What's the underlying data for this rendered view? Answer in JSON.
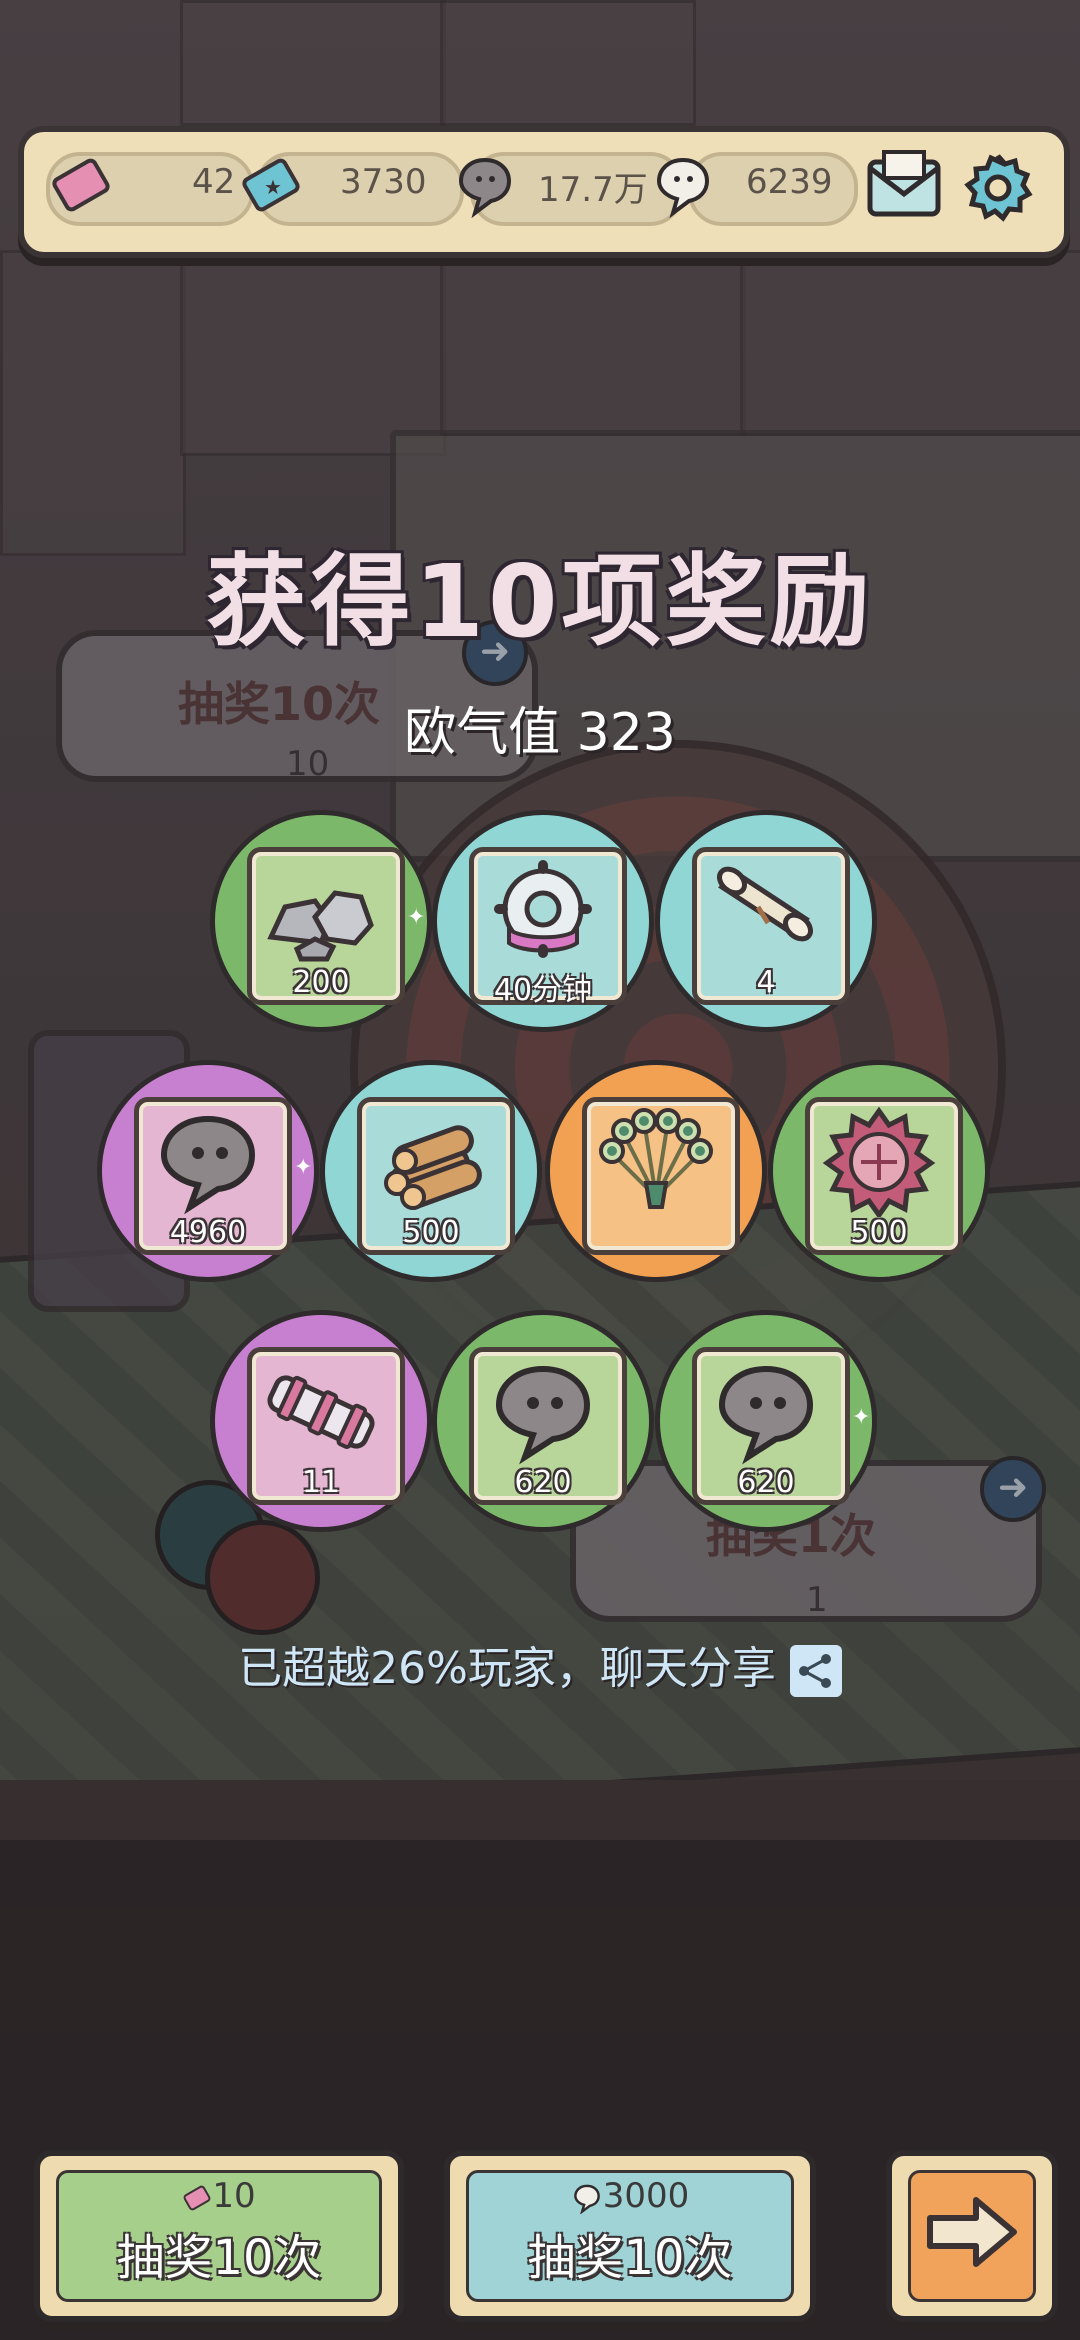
{
  "topbar": {
    "ticket_pink": {
      "icon": "pink-ticket-icon",
      "value": "42"
    },
    "ticket_blue": {
      "icon": "blue-ticket-icon",
      "value": "3730"
    },
    "dark_blob": {
      "icon": "dark-blob-icon",
      "value": "17.7万"
    },
    "white_blob": {
      "icon": "white-blob-icon",
      "value": "6239"
    },
    "mail": {
      "icon": "mail-icon"
    },
    "settings": {
      "icon": "gear-icon"
    }
  },
  "panel": {
    "title": "获得10项奖励",
    "luck_label": "欧气值 323",
    "share_text": "已超越26%玩家，聊天分享",
    "share_icon": "share-icon"
  },
  "background_text": {
    "draw10": "抽奖10次",
    "draw10_cost": "10",
    "draw1": "抽奖1次",
    "draw1_cost": "1"
  },
  "rewards": [
    {
      "name": "stones",
      "icon": "stone-pile-icon",
      "qty": "200",
      "rarity": "green",
      "sparkle": true
    },
    {
      "name": "gear-time",
      "icon": "gear-clock-icon",
      "qty": "40分钟",
      "rarity": "teal",
      "sparkle": false
    },
    {
      "name": "scroll",
      "icon": "scroll-icon",
      "qty": "4",
      "rarity": "teal",
      "sparkle": false
    },
    {
      "name": "dark-blob",
      "icon": "dark-blob-icon",
      "qty": "4960",
      "rarity": "purple",
      "sparkle": true
    },
    {
      "name": "logs",
      "icon": "wood-logs-icon",
      "qty": "500",
      "rarity": "teal",
      "sparkle": false
    },
    {
      "name": "peacock-fan",
      "icon": "peacock-fan-icon",
      "qty": "",
      "rarity": "orange",
      "sparkle": false
    },
    {
      "name": "shell",
      "icon": "spiky-shell-icon",
      "qty": "500",
      "rarity": "green",
      "sparkle": false
    },
    {
      "name": "cannon",
      "icon": "cannon-part-icon",
      "qty": "11",
      "rarity": "purple",
      "sparkle": false
    },
    {
      "name": "dark-blob-2",
      "icon": "dark-blob-icon",
      "qty": "620",
      "rarity": "green",
      "sparkle": false
    },
    {
      "name": "dark-blob-3",
      "icon": "dark-blob-icon",
      "qty": "620",
      "rarity": "green",
      "sparkle": true
    }
  ],
  "buttons": {
    "draw10_ticket": {
      "cost": "10",
      "cost_icon": "pink-ticket-icon",
      "label": "抽奖10次",
      "color": "#a7cf8c"
    },
    "draw10_blob": {
      "cost": "3000",
      "cost_icon": "white-blob-icon",
      "label": "抽奖10次",
      "color": "#9fd3d6"
    },
    "next": {
      "icon": "right-arrow-icon",
      "color": "#f2a35b"
    }
  }
}
